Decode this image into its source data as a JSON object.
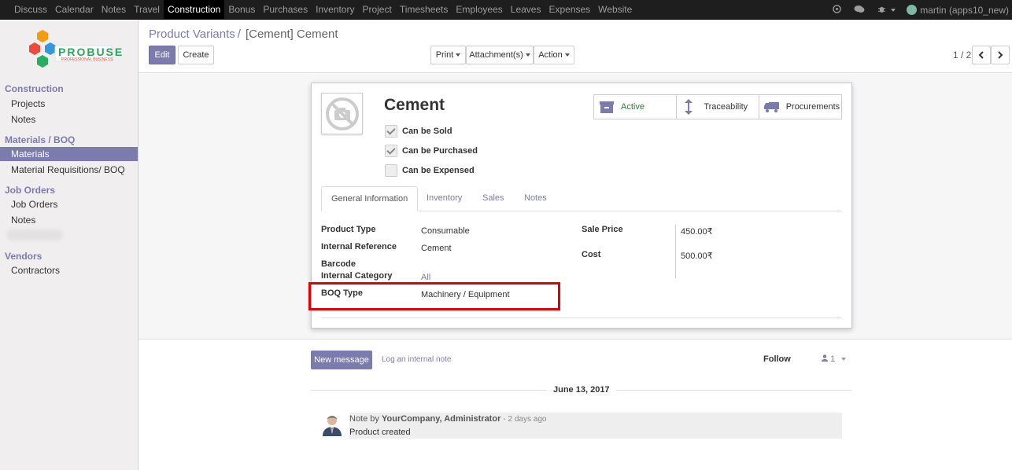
{
  "topbar": {
    "menu": [
      "Discuss",
      "Calendar",
      "Notes",
      "Travel",
      "Construction",
      "Bonus",
      "Purchases",
      "Inventory",
      "Project",
      "Timesheets",
      "Employees",
      "Leaves",
      "Expenses",
      "Website"
    ],
    "active": "Construction",
    "user": "martin (apps10_new)"
  },
  "sidebar": {
    "sections": [
      {
        "title": "Construction",
        "items": [
          "Projects",
          "Notes"
        ]
      },
      {
        "title": "Materials / BOQ",
        "items": [
          "Materials",
          "Material Requisitions/ BOQ"
        ]
      },
      {
        "title": "Job Orders",
        "items": [
          "Job Orders",
          "Notes"
        ]
      },
      {
        "title": "Vendors",
        "items": [
          "Contractors"
        ]
      }
    ],
    "active_item": "Materials"
  },
  "logo": {
    "name": "PROBUSE",
    "tagline": "PROFESSIONAL BUSINESS"
  },
  "breadcrumb": {
    "parent": "Product Variants",
    "separator": "/",
    "current": "[Cement] Cement"
  },
  "toolbar": {
    "edit": "Edit",
    "create": "Create",
    "print": "Print",
    "attachments": "Attachment(s)",
    "action": "Action"
  },
  "pager": {
    "value": "1 / 2"
  },
  "product": {
    "name": "Cement",
    "checkboxes": [
      {
        "label": "Can be Sold",
        "checked": true
      },
      {
        "label": "Can be Purchased",
        "checked": true
      },
      {
        "label": "Can be Expensed",
        "checked": false
      }
    ],
    "stat_buttons": [
      "Active",
      "Traceability",
      "Procurements"
    ],
    "tabs": [
      "General Information",
      "Inventory",
      "Sales",
      "Notes"
    ],
    "active_tab": "General Information",
    "fields_left": [
      {
        "label": "Product Type",
        "value": "Consumable"
      },
      {
        "label": "Internal Reference",
        "value": "Cement"
      },
      {
        "label": "Barcode",
        "value": ""
      },
      {
        "label": "Internal Category",
        "value": "All"
      },
      {
        "label": "BOQ Type",
        "value": "Machinery / Equipment"
      }
    ],
    "fields_right": [
      {
        "label": "Sale Price",
        "value": "450.00₹"
      },
      {
        "label": "Cost",
        "value": "500.00₹"
      }
    ]
  },
  "chatter": {
    "new_message": "New message",
    "log_note": "Log an internal note",
    "follow": "Follow",
    "followers": "1",
    "date": "June 13, 2017",
    "message": {
      "prefix": "Note by",
      "author": "YourCompany, Administrator",
      "ago": "- 2 days ago",
      "body": "Product created"
    }
  },
  "colors": {
    "accent": "#7c7bad",
    "active_green": "#2a7e3b",
    "highlight": "#e00000",
    "navbar": "#1e1e1e"
  }
}
